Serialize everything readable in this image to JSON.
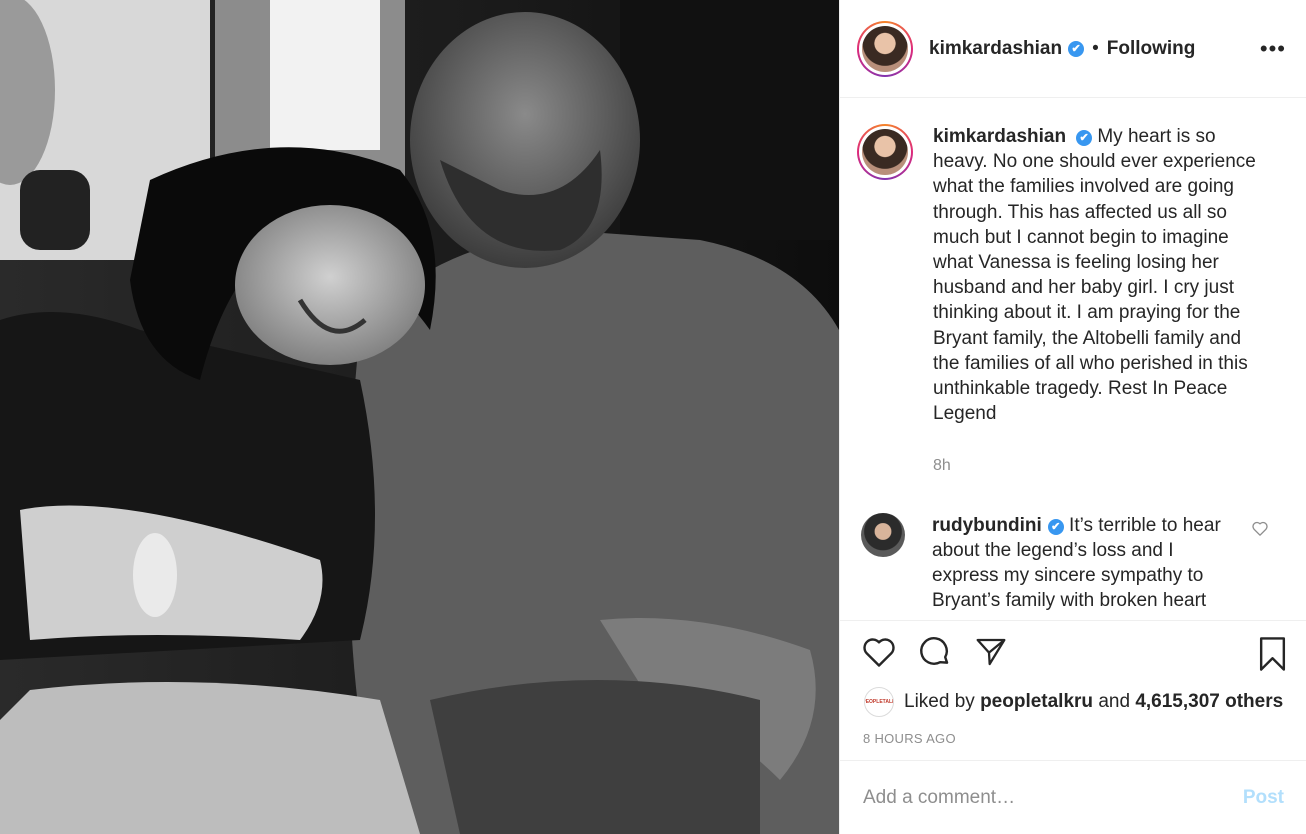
{
  "post": {
    "username": "kimkardashian",
    "verified_mark": "✔",
    "separator": "•",
    "follow_status": "Following",
    "more_label": "•••"
  },
  "caption": {
    "username": "kimkardashian",
    "text": "My heart is so heavy. No one should ever experience what the families involved are going through. This has affected us all so much but I cannot begin to imagine what Vanessa is feeling losing her husband and her baby girl. I cry just thinking about it. I am praying for the Bryant family, the Altobelli family and the families of all who perished in this unthinkable tragedy. Rest In Peace Legend",
    "time": "8h"
  },
  "comments": [
    {
      "username": "rudybundini",
      "text": "It’s terrible to hear about the legend’s loss and I express my sincere sympathy to Bryant’s family with broken heart"
    }
  ],
  "likes": {
    "prefix": "Liked by",
    "user": "peopletalkru",
    "middle": "and",
    "count": "4,615,307 others",
    "avatar_text": "PEOPLETALK"
  },
  "timestamp": "8 HOURS AGO",
  "add_comment": {
    "placeholder": "Add a comment…",
    "post_label": "Post"
  },
  "icons": {
    "like": "heart-icon",
    "comment": "comment-bubble-icon",
    "share": "paper-plane-icon",
    "save": "bookmark-icon",
    "comment_like": "heart-small-icon"
  },
  "colors": {
    "verified": "#3897f0",
    "post_button_disabled": "#b2dffc",
    "secondary_text": "#8e8e8e"
  }
}
